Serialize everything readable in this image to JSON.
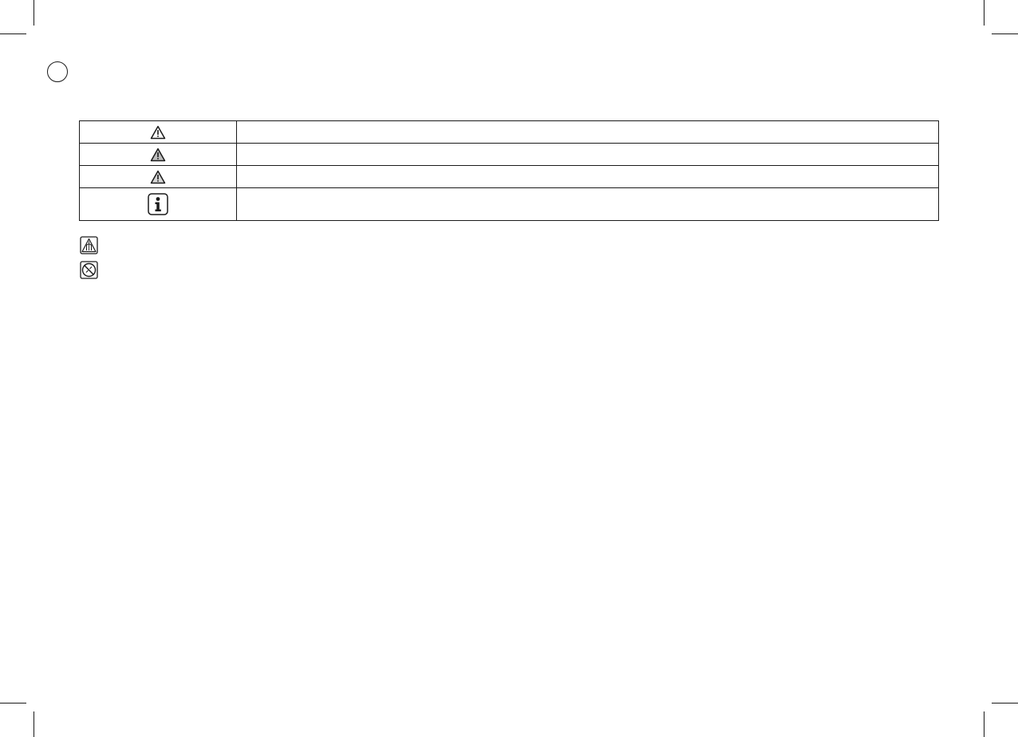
{
  "page": {
    "language_badge": ""
  },
  "legend_table": {
    "rows": [
      {
        "icon": "warning-outline-icon",
        "text": ""
      },
      {
        "icon": "warning-grey-icon",
        "text": ""
      },
      {
        "icon": "warning-grey-icon",
        "text": ""
      },
      {
        "icon": "info-icon",
        "text": ""
      }
    ]
  },
  "symbols": [
    {
      "icon": "ce-hazard-icon",
      "text": ""
    },
    {
      "icon": "no-disassemble-icon",
      "text": ""
    }
  ]
}
